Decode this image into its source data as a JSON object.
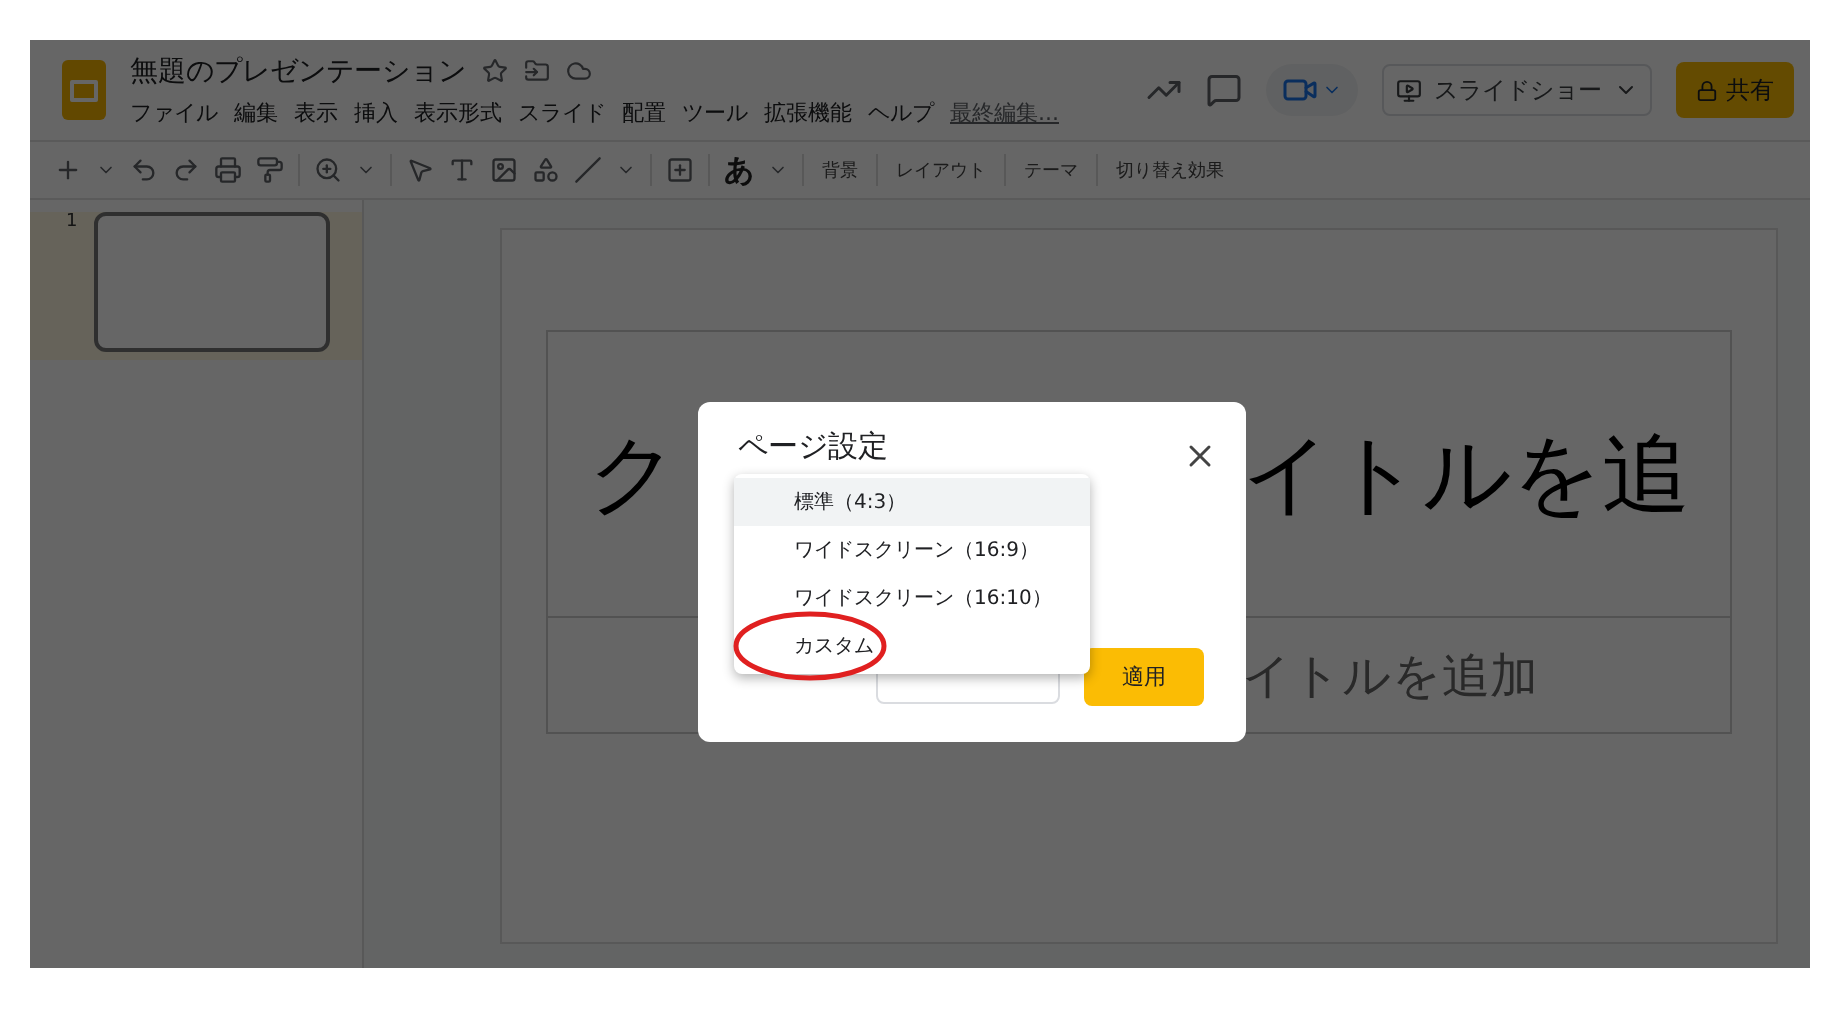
{
  "document": {
    "title": "無題のプレゼンテーション",
    "menus": [
      "ファイル",
      "編集",
      "表示",
      "挿入",
      "表示形式",
      "スライド",
      "配置",
      "ツール",
      "拡張機能",
      "ヘルプ"
    ],
    "last_edit": "最終編集..."
  },
  "header_buttons": {
    "slideshow": "スライドショー",
    "share": "共有"
  },
  "toolbar": {
    "font_button": "あ",
    "items": [
      "背景",
      "レイアウト",
      "テーマ",
      "切り替え効果"
    ]
  },
  "filmstrip": [
    {
      "number": "1",
      "selected": true
    }
  ],
  "slide": {
    "title_left": "ク",
    "title_right": "イトルを追",
    "subtitle": "イトルを追加"
  },
  "dialog": {
    "title": "ページ設定",
    "apply": "適用"
  },
  "dropdown": {
    "options": [
      {
        "label": "標準（4:3）",
        "selected": true,
        "circled": false
      },
      {
        "label": "ワイドスクリーン（16:9）",
        "selected": false,
        "circled": false
      },
      {
        "label": "ワイドスクリーン（16:10）",
        "selected": false,
        "circled": false
      },
      {
        "label": "カスタム",
        "selected": false,
        "circled": true
      }
    ]
  }
}
